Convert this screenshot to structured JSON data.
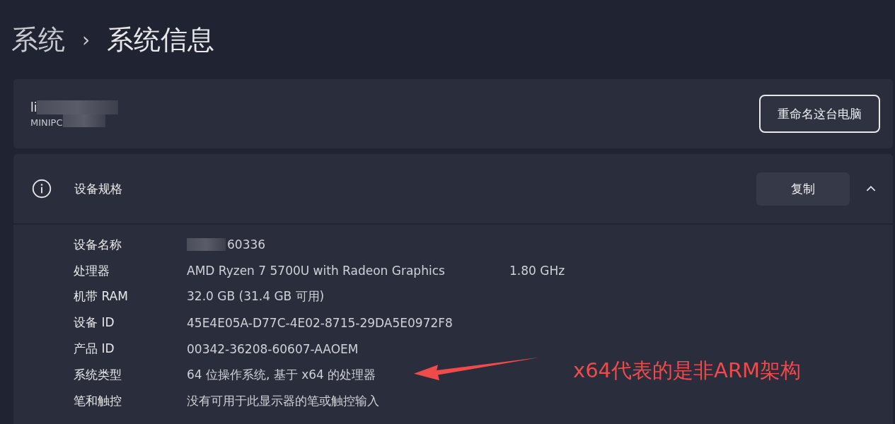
{
  "breadcrumb": [
    "系统",
    "›",
    "系统信息"
  ],
  "device_card": {
    "name": "li",
    "model": "MINIPC",
    "redacted": true,
    "rename_button": "重命名这台电脑"
  },
  "specs": {
    "title": "设备规格",
    "copy_button": "复制",
    "expanded": true,
    "rows": [
      {
        "label": "设备名称",
        "value": "60336",
        "redacted": true
      },
      {
        "label": "处理器",
        "value": "AMD Ryzen 7 5700U with Radeon Graphics",
        "extra": "1.80 GHz",
        "redacted": false
      },
      {
        "label": "机带 RAM",
        "value": "32.0 GB (31.4 GB 可用)",
        "redacted": false
      },
      {
        "label": "设备 ID",
        "value": "45E4E05A-D77C-4E02-8715-29DA5E0972F8",
        "redacted": false
      },
      {
        "label": "产品 ID",
        "value": "00342-36208-60607-AAOEM",
        "redacted": false
      },
      {
        "label": "系统类型",
        "value": "64 位操作系统, 基于 x64 的处理器",
        "redacted": false
      },
      {
        "label": "笔和触控",
        "value": "没有可用于此显示器的笔或触控输入",
        "redacted": false
      }
    ]
  },
  "annotation": {
    "text": "x64代表的是非ARM架构",
    "color": "#f04b4b"
  }
}
